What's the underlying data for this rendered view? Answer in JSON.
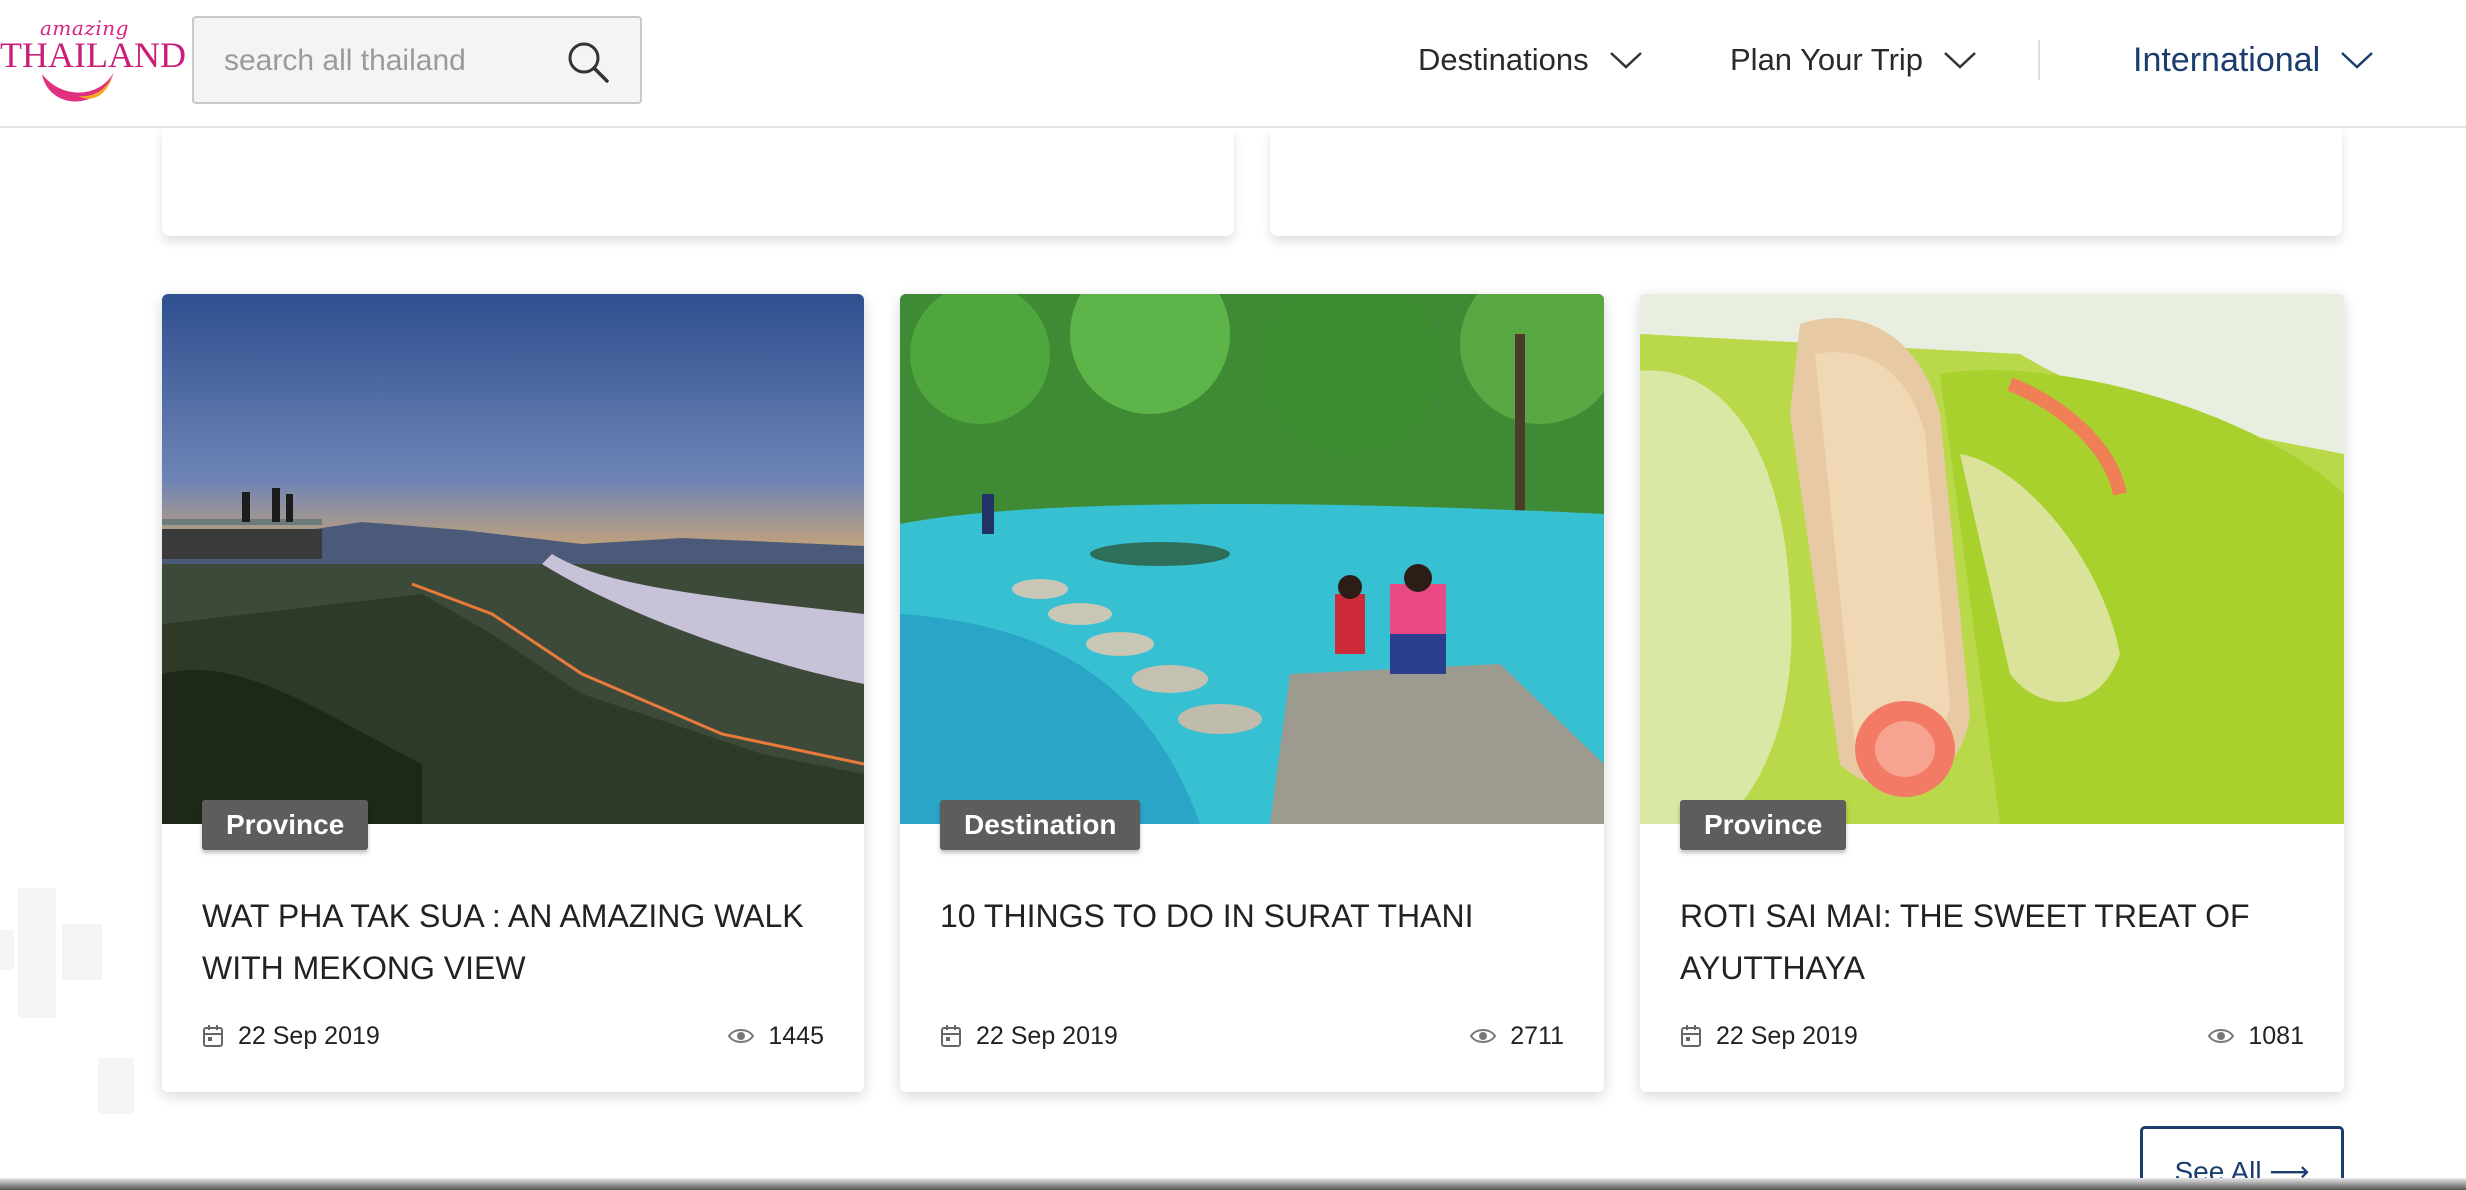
{
  "header": {
    "logo": {
      "small": "amazing",
      "big": "THAILAND"
    },
    "search": {
      "placeholder": "search all thailand"
    },
    "nav": [
      {
        "label": "Destinations"
      },
      {
        "label": "Plan Your Trip"
      },
      {
        "label": "International"
      }
    ]
  },
  "cards": [
    {
      "category": "Province",
      "title": "WAT PHA TAK SUA : AN AMAZING WALK WITH MEKONG VIEW",
      "date": "22 Sep 2019",
      "views": "1445"
    },
    {
      "category": "Destination",
      "title": "10 THINGS TO DO IN SURAT THANI",
      "date": "22 Sep 2019",
      "views": "2711"
    },
    {
      "category": "Province",
      "title": "ROTI SAI MAI: THE SWEET TREAT OF AYUTTHAYA",
      "date": "22 Sep 2019",
      "views": "1081"
    }
  ],
  "see_all": {
    "label": "See All ⟶"
  },
  "colors": {
    "brand_pink": "#c81f78",
    "nav_blue": "#1b3d6e",
    "badge_gray": "#5d5d5d"
  }
}
